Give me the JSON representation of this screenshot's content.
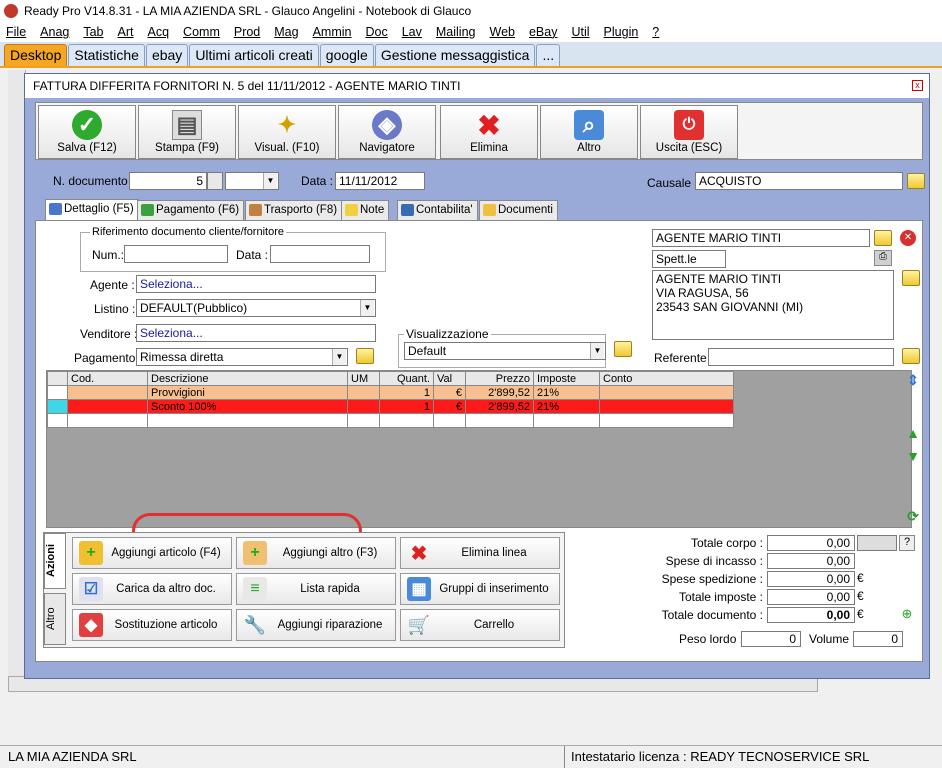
{
  "app": {
    "title": "Ready Pro V14.8.31 - LA MIA AZIENDA SRL - Glauco Angelini - Notebook di Glauco"
  },
  "menu": [
    "File",
    "Anag",
    "Tab",
    "Art",
    "Acq",
    "Comm",
    "Prod",
    "Mag",
    "Ammin",
    "Doc",
    "Lav",
    "Mailing",
    "Web",
    "eBay",
    "Util",
    "Plugin",
    "?"
  ],
  "top_tabs": [
    "Desktop",
    "Statistiche",
    "ebay",
    "Ultimi articoli creati",
    "google",
    "Gestione messaggistica",
    "..."
  ],
  "window": {
    "title": "FATTURA DIFFERITA FORNITORI N. 5  del 11/11/2012 - AGENTE MARIO TINTI",
    "close": "x"
  },
  "toolbar": {
    "salva": "Salva (F12)",
    "stampa": "Stampa (F9)",
    "visual": "Visual. (F10)",
    "navigatore": "Navigatore",
    "elimina": "Elimina",
    "altro": "Altro",
    "uscita": "Uscita (ESC)"
  },
  "header": {
    "num_label": "N. documento :",
    "num_value": "5",
    "data_label": "Data :",
    "data_value": "11/11/2012",
    "causale_label": "Causale :",
    "causale_value": "ACQUISTO"
  },
  "subtabs": [
    "Dettaglio (F5)",
    "Pagamento (F6)",
    "Trasporto (F8)",
    "Note",
    "Contabilita'",
    "Documenti"
  ],
  "form": {
    "rif_title": "Riferimento documento cliente/fornitore",
    "num_label": "Num.:",
    "data_label": "Data :",
    "agente_label": "Agente :",
    "agente_value": "Seleziona...",
    "listino_label": "Listino :",
    "listino_value": "DEFAULT(Pubblico)",
    "venditore_label": "Venditore :",
    "venditore_value": "Seleziona...",
    "pagamento_label": "Pagamento :",
    "pagamento_value": "Rimessa diretta",
    "vis_title": "Visualizzazione",
    "vis_value": "Default",
    "cliente_name": "AGENTE MARIO TINTI",
    "spett": "Spett.le",
    "address1": "AGENTE MARIO TINTI",
    "address2": "VIA RAGUSA, 56",
    "address3": "23543 SAN GIOVANNI (MI)",
    "referente_label": "Referente"
  },
  "grid": {
    "headers": [
      "Cod.",
      "Descrizione",
      "UM",
      "Quant.",
      "Val",
      "Prezzo",
      "Imposte",
      "Conto"
    ],
    "rows": [
      {
        "cod": "",
        "desc": "Provvigioni",
        "um": "",
        "qty": "1",
        "val": "€",
        "price": "2'899,52",
        "tax": "21%",
        "conto": ""
      },
      {
        "cod": "",
        "desc": "Sconto 100%",
        "um": "",
        "qty": "1",
        "val": "€",
        "price": "2'899,52",
        "tax": "21%",
        "conto": ""
      }
    ]
  },
  "actions": {
    "tab_azioni": "Azioni",
    "tab_altro": "Altro",
    "buttons": [
      "Aggiungi articolo (F4)",
      "Aggiungi altro (F3)",
      "Elimina linea",
      "Carica da altro doc.",
      "Lista rapida",
      "Gruppi di inserimento",
      "Sostituzione articolo",
      "Aggiungi riparazione",
      "Carrello"
    ]
  },
  "totals": {
    "corpo_label": "Totale corpo :",
    "corpo": "0,00",
    "help": "?",
    "incasso_label": "Spese di incasso :",
    "incasso": "0,00",
    "spedizione_label": "Spese spedizione :",
    "spedizione": "0,00",
    "imposte_label": "Totale imposte :",
    "imposte": "0,00",
    "documento_label": "Totale documento :",
    "documento": "0,00",
    "currency": "€",
    "peso_label": "Peso lordo :",
    "peso": "0",
    "volume_label": "Volume :",
    "volume": "0"
  },
  "status": {
    "left": "LA MIA AZIENDA SRL",
    "right": "Intestatario licenza : READY TECNOSERVICE SRL"
  }
}
